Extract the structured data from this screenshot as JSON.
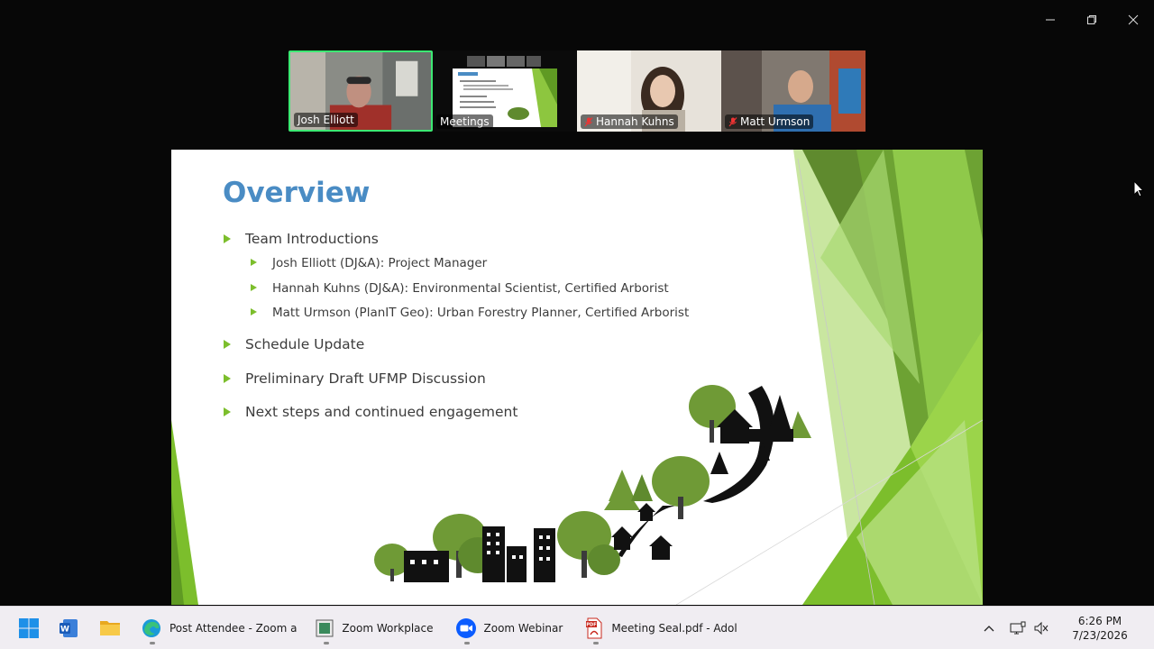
{
  "window": {
    "minimize_icon": "minimize-icon",
    "restore_icon": "restore-icon",
    "close_icon": "close-icon"
  },
  "participants": [
    {
      "name": "Josh Elliott",
      "muted": false,
      "active_speaker": true
    },
    {
      "name": "Meetings",
      "muted": false,
      "active_speaker": false
    },
    {
      "name": "Hannah Kuhns",
      "muted": true,
      "active_speaker": false
    },
    {
      "name": "Matt Urmson",
      "muted": true,
      "active_speaker": false
    }
  ],
  "slide": {
    "title": "Overview",
    "bullets": [
      {
        "text": "Team Introductions",
        "sub": [
          "Josh Elliott (DJ&A): Project Manager",
          "Hannah Kuhns (DJ&A): Environmental Scientist, Certified Arborist",
          "Matt Urmson (PlanIT Geo): Urban Forestry Planner, Certified Arborist"
        ]
      },
      {
        "text": "Schedule Update"
      },
      {
        "text": "Preliminary Draft UFMP Discussion"
      },
      {
        "text": "Next steps and continued engagement"
      }
    ],
    "colors": {
      "title": "#4a8cc4",
      "bullet": "#7cbe2c",
      "green_dark": "#5f9a23",
      "green_light": "#9bd44a",
      "tree": "#6f9a36"
    }
  },
  "taskbar": {
    "start_icon": "windows-start-icon",
    "apps": [
      {
        "icon": "word-icon",
        "label": ""
      },
      {
        "icon": "file-explorer-icon",
        "label": ""
      },
      {
        "icon": "edge-icon",
        "label": "Post Attendee - Zoom a"
      },
      {
        "icon": "zoom-workplace-icon",
        "label": "Zoom Workplace"
      },
      {
        "icon": "zoom-webinar-icon",
        "label": "Zoom Webinar"
      },
      {
        "icon": "pdf-icon",
        "label": "Meeting Seal.pdf - Adol"
      }
    ],
    "tray": {
      "chevron_icon": "chevron-up-icon",
      "network_icon": "network-icon",
      "volume_icon": "volume-muted-icon",
      "time": "6:26 PM",
      "date": "7/23/2026"
    }
  }
}
